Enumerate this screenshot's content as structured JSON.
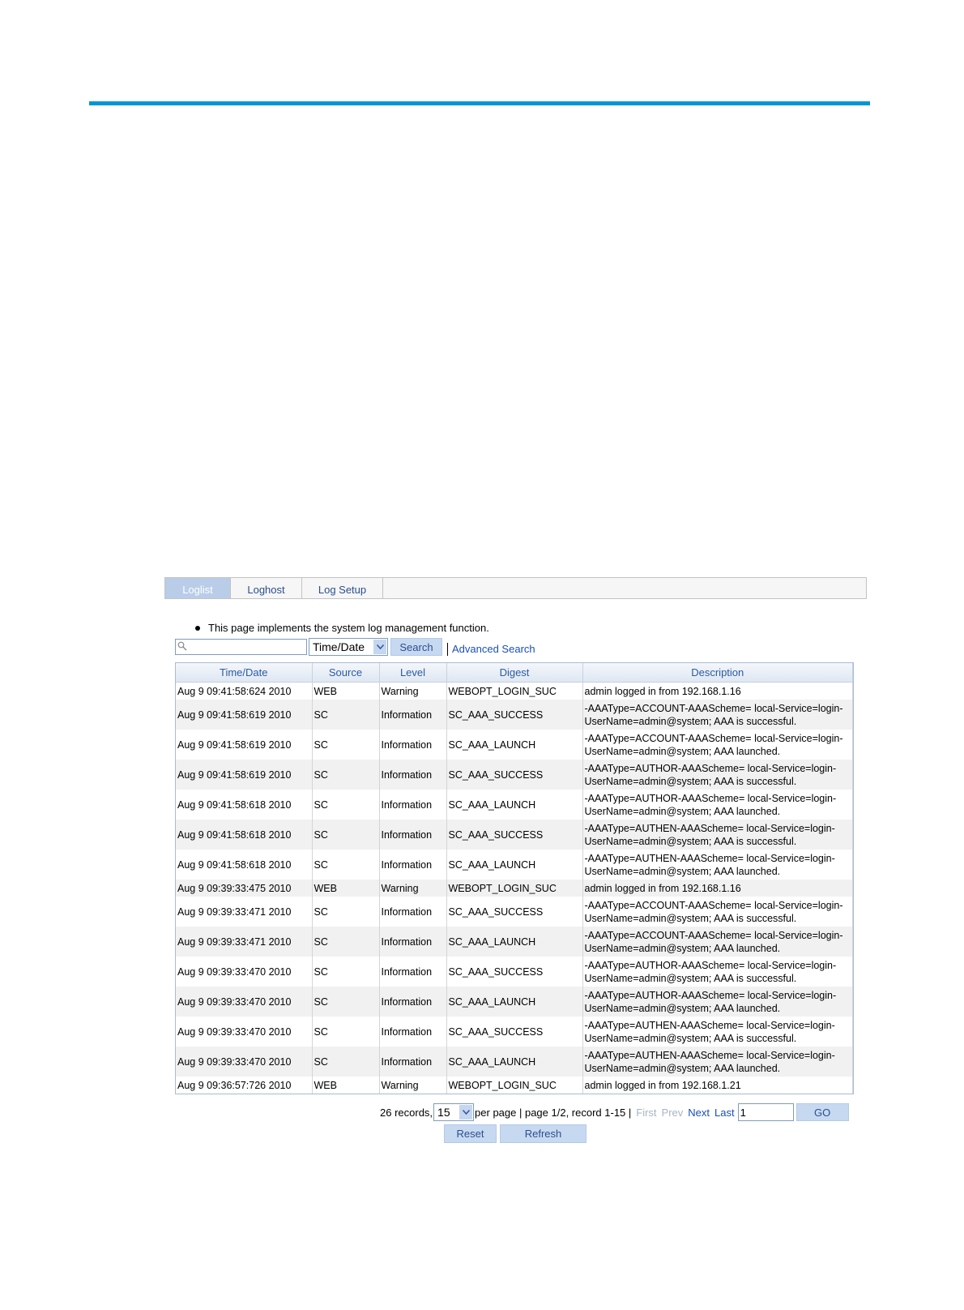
{
  "tabs": [
    {
      "label": "Loglist",
      "active": true
    },
    {
      "label": "Loghost",
      "active": false
    },
    {
      "label": "Log Setup",
      "active": false
    }
  ],
  "intro": "This page implements the system log management function.",
  "search": {
    "value": "",
    "field": "Time/Date",
    "button": "Search",
    "advanced": "Advanced Search"
  },
  "table": {
    "columns": [
      "Time/Date",
      "Source",
      "Level",
      "Digest",
      "Description"
    ],
    "rows": [
      {
        "time": "Aug  9 09:41:58:624 2010",
        "source": "WEB",
        "level": "Warning",
        "digest": "WEBOPT_LOGIN_SUC",
        "description": "admin logged in from 192.168.1.16"
      },
      {
        "time": "Aug  9 09:41:58:619 2010",
        "source": "SC",
        "level": "Information",
        "digest": "SC_AAA_SUCCESS",
        "description": "-AAAType=ACCOUNT-AAAScheme= local-Service=login-UserName=admin@system; AAA is successful."
      },
      {
        "time": "Aug  9 09:41:58:619 2010",
        "source": "SC",
        "level": "Information",
        "digest": "SC_AAA_LAUNCH",
        "description": "-AAAType=ACCOUNT-AAAScheme= local-Service=login-UserName=admin@system; AAA launched."
      },
      {
        "time": "Aug  9 09:41:58:619 2010",
        "source": "SC",
        "level": "Information",
        "digest": "SC_AAA_SUCCESS",
        "description": "-AAAType=AUTHOR-AAAScheme= local-Service=login-UserName=admin@system; AAA is successful."
      },
      {
        "time": "Aug  9 09:41:58:618 2010",
        "source": "SC",
        "level": "Information",
        "digest": "SC_AAA_LAUNCH",
        "description": "-AAAType=AUTHOR-AAAScheme= local-Service=login-UserName=admin@system; AAA launched."
      },
      {
        "time": "Aug  9 09:41:58:618 2010",
        "source": "SC",
        "level": "Information",
        "digest": "SC_AAA_SUCCESS",
        "description": "-AAAType=AUTHEN-AAAScheme= local-Service=login-UserName=admin@system; AAA is successful."
      },
      {
        "time": "Aug  9 09:41:58:618 2010",
        "source": "SC",
        "level": "Information",
        "digest": "SC_AAA_LAUNCH",
        "description": "-AAAType=AUTHEN-AAAScheme= local-Service=login-UserName=admin@system; AAA launched."
      },
      {
        "time": "Aug  9 09:39:33:475 2010",
        "source": "WEB",
        "level": "Warning",
        "digest": "WEBOPT_LOGIN_SUC",
        "description": "admin logged in from 192.168.1.16"
      },
      {
        "time": "Aug  9 09:39:33:471 2010",
        "source": "SC",
        "level": "Information",
        "digest": "SC_AAA_SUCCESS",
        "description": "-AAAType=ACCOUNT-AAAScheme= local-Service=login-UserName=admin@system; AAA is successful."
      },
      {
        "time": "Aug  9 09:39:33:471 2010",
        "source": "SC",
        "level": "Information",
        "digest": "SC_AAA_LAUNCH",
        "description": "-AAAType=ACCOUNT-AAAScheme= local-Service=login-UserName=admin@system; AAA launched."
      },
      {
        "time": "Aug  9 09:39:33:470 2010",
        "source": "SC",
        "level": "Information",
        "digest": "SC_AAA_SUCCESS",
        "description": "-AAAType=AUTHOR-AAAScheme= local-Service=login-UserName=admin@system; AAA is successful."
      },
      {
        "time": "Aug  9 09:39:33:470 2010",
        "source": "SC",
        "level": "Information",
        "digest": "SC_AAA_LAUNCH",
        "description": "-AAAType=AUTHOR-AAAScheme= local-Service=login-UserName=admin@system; AAA launched."
      },
      {
        "time": "Aug  9 09:39:33:470 2010",
        "source": "SC",
        "level": "Information",
        "digest": "SC_AAA_SUCCESS",
        "description": "-AAAType=AUTHEN-AAAScheme= local-Service=login-UserName=admin@system; AAA is successful."
      },
      {
        "time": "Aug  9 09:39:33:470 2010",
        "source": "SC",
        "level": "Information",
        "digest": "SC_AAA_LAUNCH",
        "description": "-AAAType=AUTHEN-AAAScheme= local-Service=login-UserName=admin@system; AAA launched."
      },
      {
        "time": "Aug  9 09:36:57:726 2010",
        "source": "WEB",
        "level": "Warning",
        "digest": "WEBOPT_LOGIN_SUC",
        "description": "admin logged in from 192.168.1.21"
      }
    ]
  },
  "pager": {
    "records": "26 records,",
    "per_page_value": "15",
    "summary": "per page | page 1/2, record 1-15 |",
    "first": "First",
    "prev": "Prev",
    "next": "Next",
    "last": "Last",
    "page_value": "1",
    "go": "GO"
  },
  "actions": {
    "reset": "Reset",
    "refresh": "Refresh"
  },
  "colors": {
    "accent_rule": "#0096d6",
    "active_tab": "#b9cde8",
    "link": "#1a4fb8"
  },
  "icons": {
    "search": "search-icon",
    "dropdown": "chevron-down-icon"
  }
}
